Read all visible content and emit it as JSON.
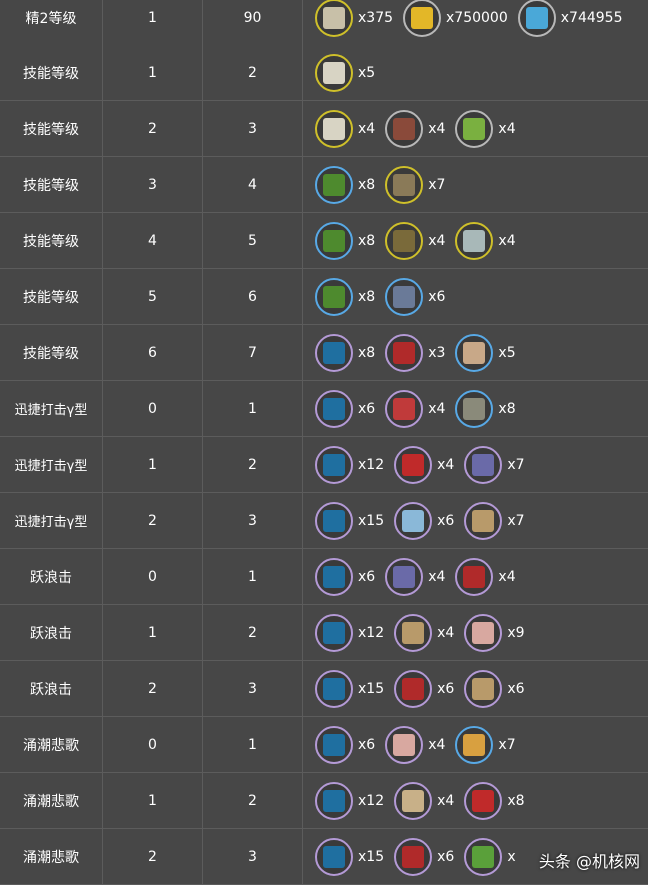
{
  "rows": [
    {
      "skill": "精2等级",
      "from": "1",
      "to": "90",
      "mats": [
        {
          "icon": "exp-card-icon",
          "ring": "gold",
          "color": "#c8c0a8",
          "qty": "x375"
        },
        {
          "icon": "exp-badge-icon",
          "ring": "gray",
          "color": "#e3b728",
          "qty": "x750000"
        },
        {
          "icon": "lmd-money-icon",
          "ring": "gray",
          "color": "#4aa8d8",
          "qty": "x744955"
        }
      ]
    },
    {
      "skill": "技能等级",
      "from": "1",
      "to": "2",
      "mats": [
        {
          "icon": "skill-book-1-icon",
          "ring": "gold",
          "color": "#d8d4c4",
          "qty": "x5"
        }
      ]
    },
    {
      "skill": "技能等级",
      "from": "2",
      "to": "3",
      "mats": [
        {
          "icon": "skill-book-1-icon",
          "ring": "gold",
          "color": "#d8d4c4",
          "qty": "x4"
        },
        {
          "icon": "device-gray-icon",
          "ring": "gray",
          "color": "#8a4a3a",
          "qty": "x4"
        },
        {
          "icon": "ester-green-icon",
          "ring": "gray",
          "color": "#7ab040",
          "qty": "x4"
        }
      ]
    },
    {
      "skill": "技能等级",
      "from": "3",
      "to": "4",
      "mats": [
        {
          "icon": "skill-book-2-icon",
          "ring": "blue",
          "color": "#4e8a2e",
          "qty": "x8"
        },
        {
          "icon": "polyketon-icon",
          "ring": "gold",
          "color": "#8a7a58",
          "qty": "x7"
        }
      ]
    },
    {
      "skill": "技能等级",
      "from": "4",
      "to": "5",
      "mats": [
        {
          "icon": "skill-book-2-icon",
          "ring": "blue",
          "color": "#4e8a2e",
          "qty": "x8"
        },
        {
          "icon": "orirock-cube-icon",
          "ring": "gold",
          "color": "#7a6a3a",
          "qty": "x4"
        },
        {
          "icon": "vial-icon",
          "ring": "gold",
          "color": "#a8b8b8",
          "qty": "x4"
        }
      ]
    },
    {
      "skill": "技能等级",
      "from": "5",
      "to": "6",
      "mats": [
        {
          "icon": "skill-book-2-icon",
          "ring": "blue",
          "color": "#4e8a2e",
          "qty": "x8"
        },
        {
          "icon": "oriron-cluster-icon",
          "ring": "blue",
          "color": "#6a7a98",
          "qty": "x6"
        }
      ]
    },
    {
      "skill": "技能等级",
      "from": "6",
      "to": "7",
      "mats": [
        {
          "icon": "skill-book-3-icon",
          "ring": "purple",
          "color": "#1f6fa0",
          "qty": "x8"
        },
        {
          "icon": "device-red-icon",
          "ring": "purple",
          "color": "#b02a2a",
          "qty": "x3"
        },
        {
          "icon": "integrated-device-icon",
          "ring": "blue",
          "color": "#c8a888",
          "qty": "x5"
        }
      ]
    },
    {
      "skill": "迅捷打击γ型",
      "small": true,
      "from": "0",
      "to": "1",
      "mats": [
        {
          "icon": "skill-book-3-icon",
          "ring": "purple",
          "color": "#1f6fa0",
          "qty": "x6"
        },
        {
          "icon": "crystal-device-icon",
          "ring": "purple",
          "color": "#c03a3a",
          "qty": "x4"
        },
        {
          "icon": "oriron-block-icon",
          "ring": "blue",
          "color": "#8a8a7a",
          "qty": "x8"
        }
      ]
    },
    {
      "skill": "迅捷打击γ型",
      "small": true,
      "from": "1",
      "to": "2",
      "mats": [
        {
          "icon": "skill-book-3-icon",
          "ring": "purple",
          "color": "#1f6fa0",
          "qty": "x12"
        },
        {
          "icon": "red-crystal-icon",
          "ring": "purple",
          "color": "#c02a2a",
          "qty": "x4"
        },
        {
          "icon": "purple-cube-icon",
          "ring": "purple",
          "color": "#6a6aa8",
          "qty": "x7"
        }
      ]
    },
    {
      "skill": "迅捷打击γ型",
      "small": true,
      "from": "2",
      "to": "3",
      "mats": [
        {
          "icon": "skill-book-3-icon",
          "ring": "purple",
          "color": "#1f6fa0",
          "qty": "x15"
        },
        {
          "icon": "crystal-circuit-icon",
          "ring": "purple",
          "color": "#8ab8d8",
          "qty": "x6"
        },
        {
          "icon": "orirock-concentrate-icon",
          "ring": "purple",
          "color": "#b89a6a",
          "qty": "x7"
        }
      ]
    },
    {
      "skill": "跃浪击",
      "from": "0",
      "to": "1",
      "mats": [
        {
          "icon": "skill-book-3-icon",
          "ring": "purple",
          "color": "#1f6fa0",
          "qty": "x6"
        },
        {
          "icon": "purple-cube-icon",
          "ring": "purple",
          "color": "#6a6aa8",
          "qty": "x4"
        },
        {
          "icon": "device-red-icon",
          "ring": "purple",
          "color": "#b02a2a",
          "qty": "x4"
        }
      ]
    },
    {
      "skill": "跃浪击",
      "from": "1",
      "to": "2",
      "mats": [
        {
          "icon": "skill-book-3-icon",
          "ring": "purple",
          "color": "#1f6fa0",
          "qty": "x12"
        },
        {
          "icon": "orirock-concentrate-icon",
          "ring": "purple",
          "color": "#b89a6a",
          "qty": "x4"
        },
        {
          "icon": "keton-colloid-icon",
          "ring": "purple",
          "color": "#d8a8a0",
          "qty": "x9"
        }
      ]
    },
    {
      "skill": "跃浪击",
      "from": "2",
      "to": "3",
      "mats": [
        {
          "icon": "skill-book-3-icon",
          "ring": "purple",
          "color": "#1f6fa0",
          "qty": "x15"
        },
        {
          "icon": "red-chest-icon",
          "ring": "purple",
          "color": "#b02a2a",
          "qty": "x6"
        },
        {
          "icon": "orirock-concentrate-icon",
          "ring": "purple",
          "color": "#b89a6a",
          "qty": "x6"
        }
      ]
    },
    {
      "skill": "涌潮悲歌",
      "from": "0",
      "to": "1",
      "mats": [
        {
          "icon": "skill-book-3-icon",
          "ring": "purple",
          "color": "#1f6fa0",
          "qty": "x6"
        },
        {
          "icon": "keton-colloid-icon",
          "ring": "purple",
          "color": "#d8a8a0",
          "qty": "x4"
        },
        {
          "icon": "manganese-icon",
          "ring": "blue",
          "color": "#d8a040",
          "qty": "x7"
        }
      ]
    },
    {
      "skill": "涌潮悲歌",
      "from": "1",
      "to": "2",
      "mats": [
        {
          "icon": "skill-book-3-icon",
          "ring": "purple",
          "color": "#1f6fa0",
          "qty": "x12"
        },
        {
          "icon": "polyester-pack-icon",
          "ring": "purple",
          "color": "#c8b088",
          "qty": "x4"
        },
        {
          "icon": "red-crystal-icon",
          "ring": "purple",
          "color": "#c02a2a",
          "qty": "x8"
        }
      ]
    },
    {
      "skill": "涌潮悲歌",
      "from": "2",
      "to": "3",
      "mats": [
        {
          "icon": "skill-book-3-icon",
          "ring": "purple",
          "color": "#1f6fa0",
          "qty": "x15"
        },
        {
          "icon": "red-chest-icon",
          "ring": "purple",
          "color": "#b02a2a",
          "qty": "x6"
        },
        {
          "icon": "green-chip-icon",
          "ring": "purple",
          "color": "#5aa03a",
          "qty": "x"
        }
      ]
    }
  ],
  "watermark": "头条 @机核网"
}
